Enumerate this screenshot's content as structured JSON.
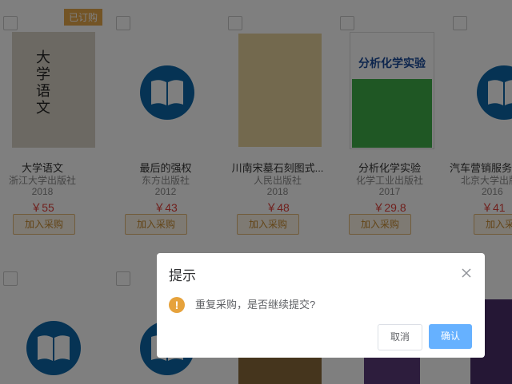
{
  "books": [
    {
      "title": "大学语文",
      "publisher": "浙江大学出版社",
      "year": "2018",
      "price": "￥55",
      "add_label": "加入采购",
      "badge": "已订购",
      "cover_text": "大学语文"
    },
    {
      "title": "最后的强权",
      "publisher": "东方出版社",
      "year": "2012",
      "price": "￥43",
      "add_label": "加入采购"
    },
    {
      "title": "川南宋墓石刻图式...",
      "publisher": "人民出版社",
      "year": "2018",
      "price": "￥48",
      "add_label": "加入采购"
    },
    {
      "title": "分析化学实验",
      "publisher": "化学工业出版社",
      "year": "2017",
      "price": "￥29.8",
      "add_label": "加入采购",
      "cover_text": "分析化学实验"
    },
    {
      "title": "汽车营销服务",
      "publisher": "北京大学出版社",
      "year": "2016",
      "price": "￥41",
      "add_label": "加入采购"
    }
  ],
  "dialog": {
    "title": "提示",
    "message": "重复采购，是否继续提交?",
    "cancel_label": "取消",
    "confirm_label": "确认"
  },
  "colors": {
    "accent_orange": "#e7a84a",
    "price_red": "#e0403a",
    "confirm_blue": "#66b1ff",
    "icon_blue": "#0d66a8"
  }
}
